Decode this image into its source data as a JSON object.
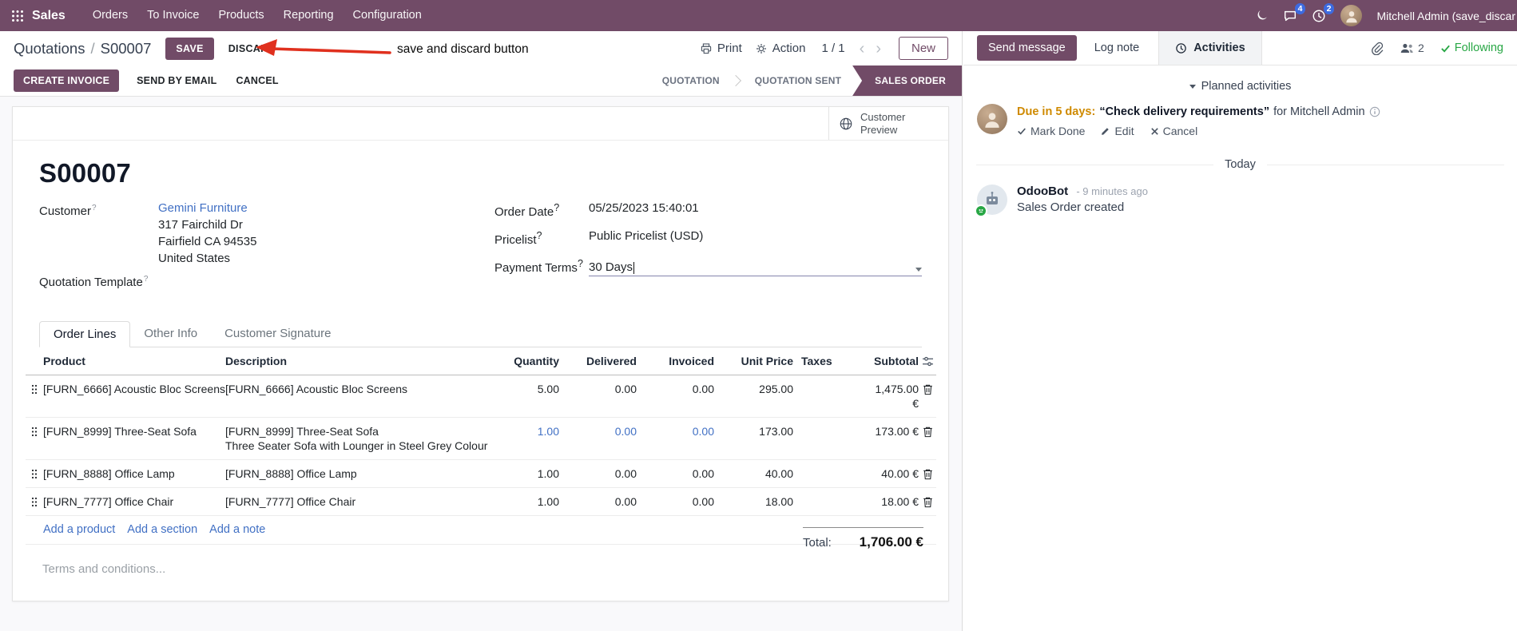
{
  "colors": {
    "primary": "#714B67",
    "link": "#4170c4",
    "due_warning": "#cf8a00",
    "following_green": "#28a745",
    "badge_blue": "#3d6be0",
    "annotation_red": "#e0301e",
    "active_state_bg": "#714B67"
  },
  "topbar": {
    "app_name": "Sales",
    "menus": [
      "Orders",
      "To Invoice",
      "Products",
      "Reporting",
      "Configuration"
    ],
    "messages_badge": "4",
    "activities_badge": "2",
    "user_name": "Mitchell Admin (save_discar"
  },
  "breadcrumb": {
    "path": "Quotations",
    "separator": "/",
    "current": "S00007",
    "save": "SAVE",
    "discard": "DISCARD"
  },
  "annotation": {
    "text": "save and discard button"
  },
  "control_panel": {
    "print": "Print",
    "action": "Action",
    "pager": "1 / 1",
    "prev": "‹",
    "next": "›",
    "new": "New"
  },
  "statusbar": {
    "create_invoice": "CREATE INVOICE",
    "send_by_email": "SEND BY EMAIL",
    "cancel": "CANCEL",
    "states": [
      "QUOTATION",
      "QUOTATION SENT",
      "SALES ORDER"
    ],
    "active_state": "SALES ORDER"
  },
  "form": {
    "customer_preview": "Customer Preview",
    "help_marker": "?",
    "title": "S00007",
    "customer_label": "Customer",
    "customer_name": "Gemini Furniture",
    "address_line1": "317 Fairchild Dr",
    "address_line2": "Fairfield CA 94535",
    "address_line3": "United States",
    "quotation_template_label": "Quotation Template",
    "order_date_label": "Order Date",
    "order_date_value": "05/25/2023 15:40:01",
    "pricelist_label": "Pricelist",
    "pricelist_value": "Public Pricelist (USD)",
    "payment_terms_label": "Payment Terms",
    "payment_terms_value": "30 Days",
    "tabs": [
      "Order Lines",
      "Other Info",
      "Customer Signature"
    ],
    "table": {
      "headers": [
        "Product",
        "Description",
        "Quantity",
        "Delivered",
        "Invoiced",
        "Unit Price",
        "Taxes",
        "Subtotal"
      ],
      "rows": [
        {
          "product": "[FURN_6666] Acoustic Bloc Screens",
          "description": "[FURN_6666] Acoustic Bloc Screens",
          "description2": "",
          "quantity": "5.00",
          "delivered": "0.00",
          "invoiced": "0.00",
          "unit_price": "295.00",
          "taxes": "",
          "subtotal": "1,475.00 €"
        },
        {
          "product": "[FURN_8999] Three-Seat Sofa",
          "description": "[FURN_8999] Three-Seat Sofa",
          "description2": "Three Seater Sofa with Lounger in Steel Grey Colour",
          "quantity": "1.00",
          "delivered": "0.00",
          "invoiced": "0.00",
          "unit_price": "173.00",
          "taxes": "",
          "subtotal": "173.00 €"
        },
        {
          "product": "[FURN_8888] Office Lamp",
          "description": "[FURN_8888] Office Lamp",
          "description2": "",
          "quantity": "1.00",
          "delivered": "0.00",
          "invoiced": "0.00",
          "unit_price": "40.00",
          "taxes": "",
          "subtotal": "40.00 €"
        },
        {
          "product": "[FURN_7777] Office Chair",
          "description": "[FURN_7777] Office Chair",
          "description2": "",
          "quantity": "1.00",
          "delivered": "0.00",
          "invoiced": "0.00",
          "unit_price": "18.00",
          "taxes": "",
          "subtotal": "18.00 €"
        }
      ],
      "add_links": [
        "Add a product",
        "Add a section",
        "Add a note"
      ]
    },
    "terms_placeholder": "Terms and conditions...",
    "total_label": "Total:",
    "total_value": "1,706.00 €"
  },
  "chatter": {
    "send_message": "Send message",
    "log_note": "Log note",
    "activities_tab": "Activities",
    "followers_count": "2",
    "following": "Following",
    "planned_header": "Planned activities",
    "activity": {
      "due": "Due in 5 days:",
      "summary": "“Check delivery requirements”",
      "assignee": "for Mitchell Admin",
      "mark_done": "Mark Done",
      "edit": "Edit",
      "cancel": "Cancel"
    },
    "date_divider": "Today",
    "message": {
      "author": "OdooBot",
      "time": "- 9 minutes ago",
      "body": "Sales Order created"
    }
  }
}
